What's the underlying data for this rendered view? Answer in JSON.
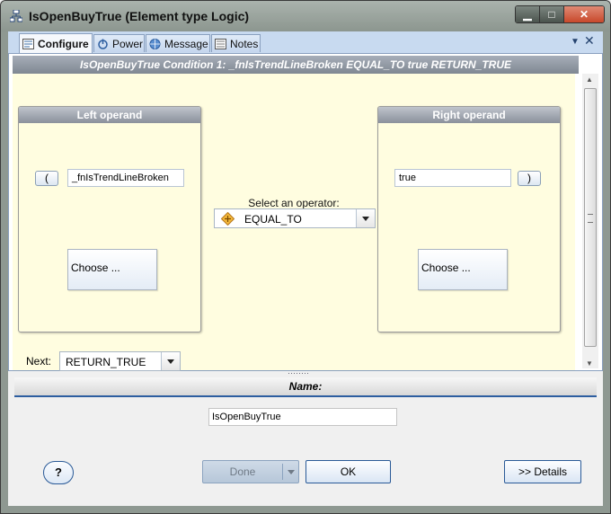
{
  "window": {
    "title": "IsOpenBuyTrue (Element type Logic)",
    "controls": {
      "minimize": "▁",
      "maximize": "□",
      "close": "✕"
    }
  },
  "tabs": [
    {
      "label": "Configure",
      "icon": "configure-icon",
      "active": true
    },
    {
      "label": "Power",
      "icon": "power-icon",
      "active": false
    },
    {
      "label": "Message",
      "icon": "message-icon",
      "active": false
    },
    {
      "label": "Notes",
      "icon": "notes-icon",
      "active": false
    }
  ],
  "condition_header": "IsOpenBuyTrue  Condition 1:  _fnIsTrendLineBroken EQUAL_TO true  RETURN_TRUE",
  "left_operand": {
    "title": "Left operand",
    "open_paren": "(",
    "value": "_fnIsTrendLineBroken",
    "choose_label": "Choose ..."
  },
  "operator": {
    "label": "Select an operator:",
    "value": "EQUAL_TO",
    "icon": "operator-icon"
  },
  "right_operand": {
    "title": "Right operand",
    "close_paren": ")",
    "value": "true",
    "choose_label": "Choose ..."
  },
  "next": {
    "label": "Next:",
    "value": "RETURN_TRUE"
  },
  "name_section": {
    "title": "Name:",
    "value": "IsOpenBuyTrue"
  },
  "buttons": {
    "help": "?",
    "done": "Done",
    "ok": "OK",
    "details": ">> Details"
  },
  "colors": {
    "canvas_bg": "#fffde0",
    "header_bar": "#8a909b",
    "accent_blue": "#2d5ea0",
    "title_bar": "#8c968f"
  }
}
